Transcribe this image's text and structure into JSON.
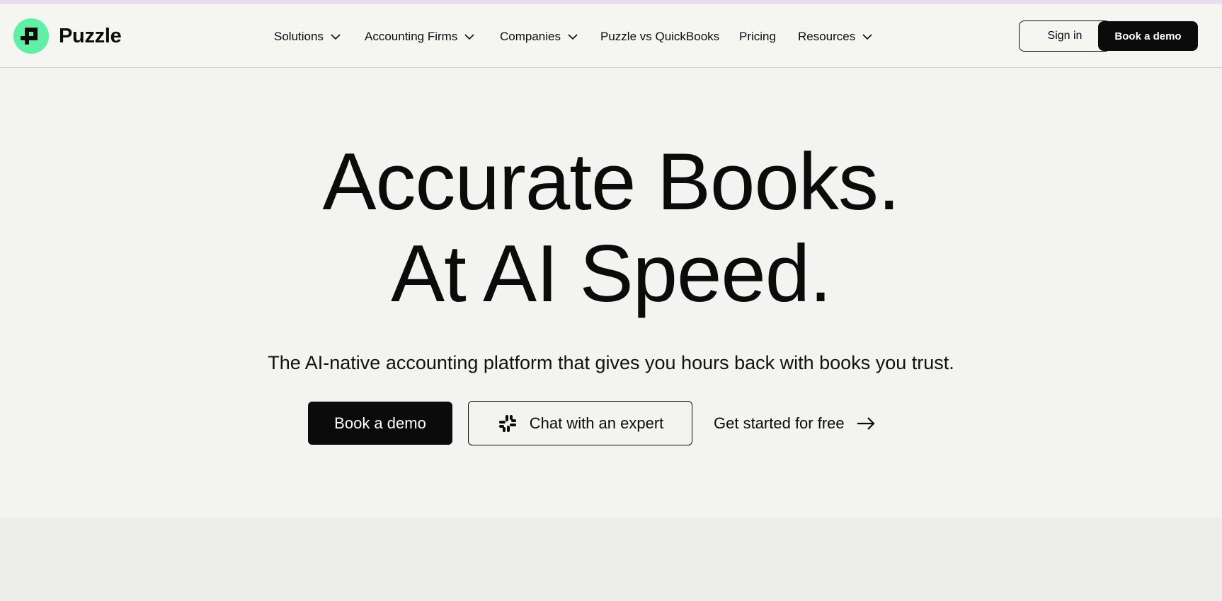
{
  "brand": {
    "name": "Puzzle",
    "accent": "#5ef0a4",
    "dark": "#0b0b0b",
    "background": "#f3f3f1"
  },
  "nav": {
    "items": [
      {
        "label": "Solutions",
        "has_dropdown": true
      },
      {
        "label": "Accounting Firms",
        "has_dropdown": true
      },
      {
        "label": "Companies",
        "has_dropdown": true
      },
      {
        "label": "Puzzle vs QuickBooks",
        "has_dropdown": false
      },
      {
        "label": "Pricing",
        "has_dropdown": false
      },
      {
        "label": "Resources",
        "has_dropdown": true
      }
    ],
    "sign_in": "Sign in",
    "book_demo": "Book a demo"
  },
  "hero": {
    "line1": "Accurate Books.",
    "line2": "At AI Speed.",
    "subtitle": "The AI-native accounting platform that gives you hours back with books you trust.",
    "cta_primary": "Book a demo",
    "cta_secondary": "Chat with an expert",
    "cta_secondary_icon": "slack-icon",
    "cta_tertiary": "Get started for free",
    "cta_tertiary_icon": "arrow-right-icon"
  }
}
